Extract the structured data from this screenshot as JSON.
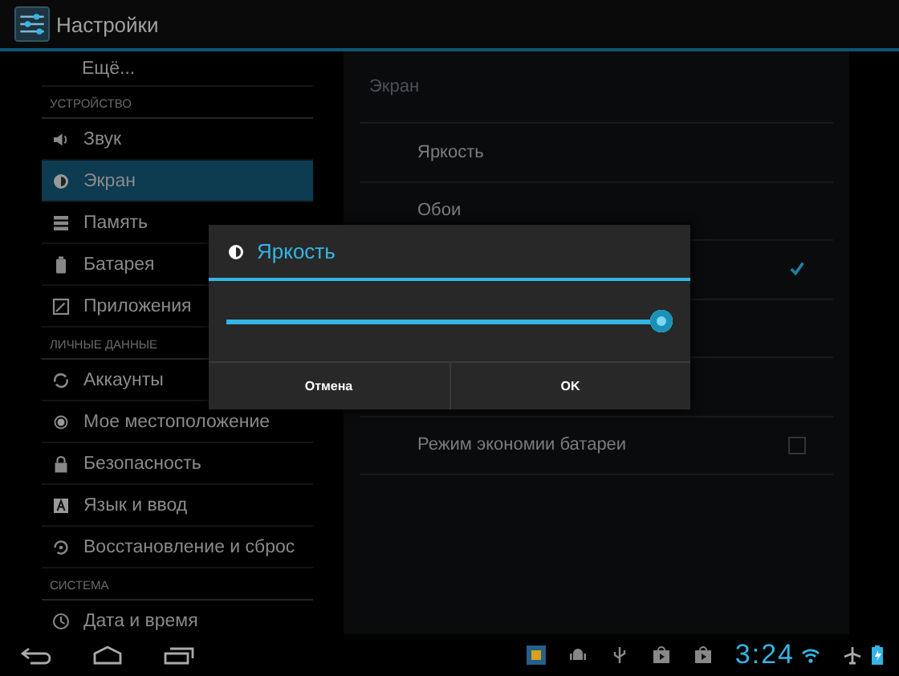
{
  "action_bar": {
    "title": "Настройки"
  },
  "sidebar": {
    "top_item": {
      "label": "Ещё...",
      "selected": false
    },
    "sections": [
      {
        "title": "УСТРОЙСТВО",
        "items": [
          {
            "label": "Звук",
            "selected": false
          },
          {
            "label": "Экран",
            "selected": true
          },
          {
            "label": "Память",
            "selected": false
          },
          {
            "label": "Батарея",
            "selected": false
          },
          {
            "label": "Приложения",
            "selected": false
          }
        ]
      },
      {
        "title": "ЛИЧНЫЕ ДАННЫЕ",
        "items": [
          {
            "label": "Аккаунты",
            "selected": false
          },
          {
            "label": "Мое местоположение",
            "selected": false
          },
          {
            "label": "Безопасность",
            "selected": false
          },
          {
            "label": "Язык и ввод",
            "selected": false
          },
          {
            "label": "Восстановление и сброс",
            "selected": false
          }
        ]
      },
      {
        "title": "СИСТЕМА",
        "items": [
          {
            "label": "Дата и время",
            "selected": false
          }
        ]
      }
    ]
  },
  "panel": {
    "title": "Экран",
    "rows": [
      {
        "kind": "link",
        "label": "Яркость"
      },
      {
        "kind": "link",
        "label": "Обои"
      },
      {
        "kind": "checkbox",
        "checked": true
      },
      {
        "kind": "link"
      },
      {
        "kind": "link"
      },
      {
        "kind": "checkbox",
        "label": "Режим экономии батареи",
        "checked": false
      }
    ]
  },
  "dialog": {
    "title": "Яркость",
    "slider": {
      "level": 0.98
    },
    "buttons": [
      "Отмена",
      "OK"
    ]
  },
  "status_bar": {
    "time": "3:24"
  }
}
